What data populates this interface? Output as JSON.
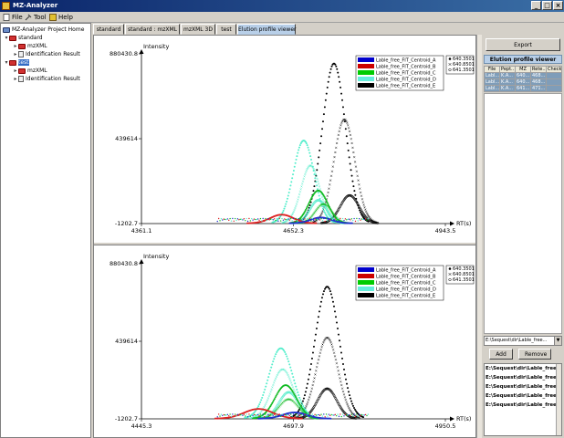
{
  "window": {
    "title": "MZ-Analyzer"
  },
  "menu": [
    {
      "label": "File",
      "icon": "file-icon"
    },
    {
      "label": "Tool",
      "icon": "tool-icon"
    },
    {
      "label": "Help",
      "icon": "help-icon"
    }
  ],
  "tree": {
    "root": "MZ-Analyzer Project Home",
    "nodes": [
      {
        "label": "standard",
        "level": 1,
        "icon": "folder-icon"
      },
      {
        "label": "mzXML",
        "level": 2,
        "icon": "folder-icon"
      },
      {
        "label": "Identification Result",
        "level": 2,
        "icon": "document-icon"
      },
      {
        "label": "test",
        "level": 1,
        "icon": "folder-icon",
        "selected": true
      },
      {
        "label": "mzXML",
        "level": 2,
        "icon": "folder-icon"
      },
      {
        "label": "Identification Result",
        "level": 2,
        "icon": "document-icon"
      }
    ]
  },
  "tabs": [
    {
      "label": "standard"
    },
    {
      "label": "standard : mzXML"
    },
    {
      "label": "mzXML 3D"
    },
    {
      "label": "test"
    },
    {
      "label": "Elution profile viewer",
      "active": true
    }
  ],
  "right_panel": {
    "export_label": "Export",
    "header": "Elution profile viewer",
    "table_columns": [
      "File",
      "Pept..",
      "MZ",
      "Rete...",
      "Check"
    ],
    "table_rows": [
      [
        "Labl...",
        "K.A...",
        "640...",
        "468...",
        ""
      ],
      [
        "Labl...",
        "K.A...",
        "640...",
        "468...",
        ""
      ],
      [
        "Labl...",
        "K.A...",
        "641...",
        "471...",
        ""
      ]
    ],
    "file_select_value": "E:\\Sequest\\dir\\Lable_free...",
    "add_label": "Add",
    "remove_label": "Remove",
    "files": [
      "E:\\Sequest\\dir\\Lable_free_FIT_C",
      "E:\\Sequest\\dir\\Lable_free_FIT_C",
      "E:\\Sequest\\dir\\Lable_free_FIT_C",
      "E:\\Sequest\\dir\\Lable_free_FIT_C",
      "E:\\Sequest\\dir\\Lable_free_FIT_C"
    ]
  },
  "chart_data": [
    {
      "type": "scatter",
      "ylabel": "Intensity",
      "xlabel": "RT(s)",
      "yticks": [
        "880430.8",
        "439614",
        "-1202.7"
      ],
      "xticks": [
        "4361.1",
        "4652.3",
        "4943.5"
      ],
      "xlim": [
        4361.1,
        4943.5
      ],
      "ylim": [
        -1202.7,
        880430.8
      ],
      "legend": [
        "Lable_free_FIT_Centroid_A",
        "Lable_free_FIT_Centroid_B",
        "Lable_free_FIT_Centroid_C",
        "Lable_free_FIT_Centroid_D",
        "Lable_free_FIT_Centroid_E"
      ],
      "legend_colors": [
        "#0000cc",
        "#cc0000",
        "#00cc00",
        "#66eedd",
        "#000000"
      ],
      "mz_legend": [
        "640.3501",
        "640.8501",
        "641.3501"
      ],
      "mz_markers": [
        "filled-circle",
        "cross",
        "open-circle"
      ],
      "series": [
        {
          "color": "#000000",
          "marker": "filled-circle",
          "peak_x": 4730,
          "peak_y": 830000,
          "width": 22
        },
        {
          "color": "#000000",
          "marker": "cross",
          "peak_x": 4750,
          "peak_y": 540000,
          "width": 20
        },
        {
          "color": "#000000",
          "marker": "open-circle",
          "peak_x": 4760,
          "peak_y": 145000,
          "width": 18
        },
        {
          "color": "#55eecc",
          "marker": "filled-circle",
          "peak_x": 4672,
          "peak_y": 430000,
          "width": 20
        },
        {
          "color": "#55eecc",
          "marker": "cross",
          "peak_x": 4685,
          "peak_y": 300000,
          "width": 18
        },
        {
          "color": "#55eecc",
          "marker": "open-circle",
          "peak_x": 4700,
          "peak_y": 120000,
          "width": 16
        },
        {
          "color": "#11bb22",
          "marker": "filled-circle",
          "peak_x": 4700,
          "peak_y": 170000,
          "width": 18
        },
        {
          "color": "#11bb22",
          "marker": "cross",
          "peak_x": 4710,
          "peak_y": 100000,
          "width": 16
        },
        {
          "color": "#dd2222",
          "marker": "filled-circle",
          "peak_x": 4630,
          "peak_y": 45000,
          "width": 22
        },
        {
          "color": "#2233cc",
          "marker": "filled-circle",
          "peak_x": 4705,
          "peak_y": 30000,
          "width": 20
        }
      ]
    },
    {
      "type": "scatter",
      "ylabel": "Intensity",
      "xlabel": "RT(s)",
      "yticks": [
        "880430.8",
        "439614",
        "-1202.7"
      ],
      "xticks": [
        "4445.3",
        "4697.9",
        "4950.5"
      ],
      "xlim": [
        4445.3,
        4950.5
      ],
      "ylim": [
        -1202.7,
        880430.8
      ],
      "legend": [
        "Lable_free_FIT_Centroid_A",
        "Lable_free_FIT_Centroid_B",
        "Lable_free_FIT_Centroid_C",
        "Lable_free_FIT_Centroid_D",
        "Lable_free_FIT_Centroid_E"
      ],
      "legend_colors": [
        "#0000cc",
        "#cc0000",
        "#00cc00",
        "#66eedd",
        "#000000"
      ],
      "mz_legend": [
        "640.3501",
        "640.8501",
        "641.3501"
      ],
      "mz_markers": [
        "filled-circle",
        "cross",
        "open-circle"
      ],
      "series": [
        {
          "color": "#000000",
          "marker": "filled-circle",
          "peak_x": 4754,
          "peak_y": 750000,
          "width": 20
        },
        {
          "color": "#000000",
          "marker": "cross",
          "peak_x": 4754,
          "peak_y": 460000,
          "width": 18
        },
        {
          "color": "#000000",
          "marker": "open-circle",
          "peak_x": 4754,
          "peak_y": 170000,
          "width": 16
        },
        {
          "color": "#55eecc",
          "marker": "filled-circle",
          "peak_x": 4677,
          "peak_y": 400000,
          "width": 20
        },
        {
          "color": "#55eecc",
          "marker": "cross",
          "peak_x": 4680,
          "peak_y": 280000,
          "width": 18
        },
        {
          "color": "#55eecc",
          "marker": "open-circle",
          "peak_x": 4690,
          "peak_y": 150000,
          "width": 16
        },
        {
          "color": "#11bb22",
          "marker": "filled-circle",
          "peak_x": 4685,
          "peak_y": 190000,
          "width": 18
        },
        {
          "color": "#11bb22",
          "marker": "cross",
          "peak_x": 4690,
          "peak_y": 110000,
          "width": 16
        },
        {
          "color": "#dd2222",
          "marker": "filled-circle",
          "peak_x": 4640,
          "peak_y": 55000,
          "width": 24
        },
        {
          "color": "#2233cc",
          "marker": "filled-circle",
          "peak_x": 4700,
          "peak_y": 35000,
          "width": 20
        }
      ]
    }
  ]
}
